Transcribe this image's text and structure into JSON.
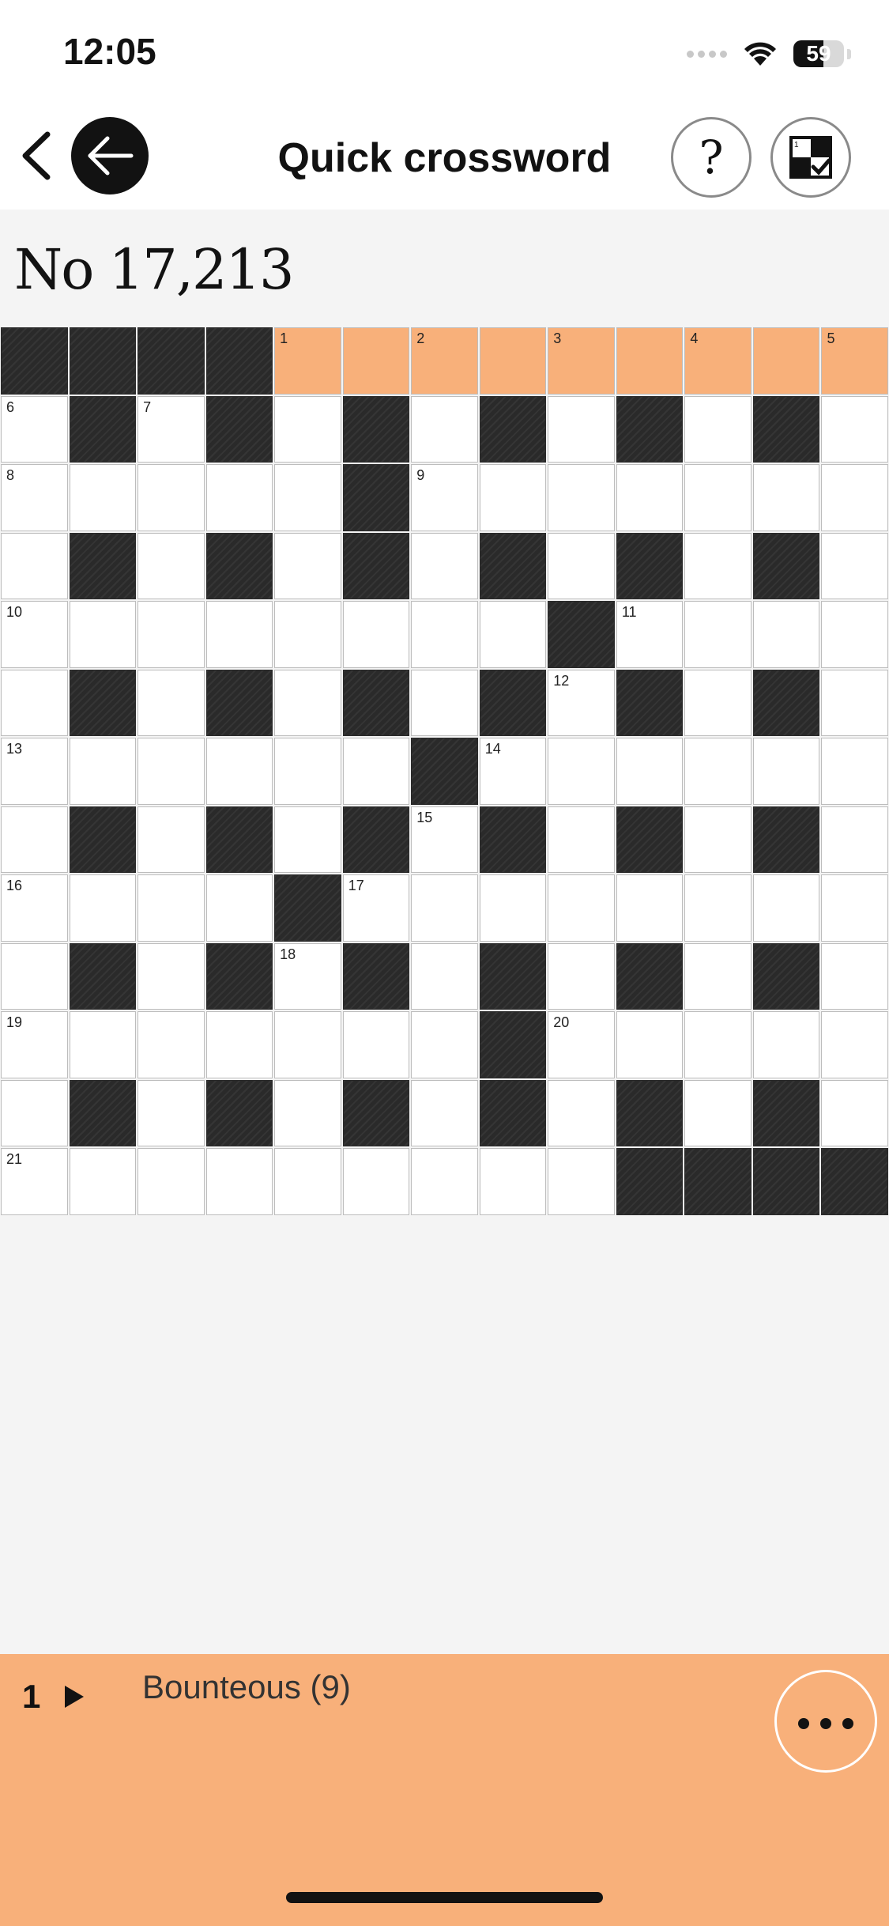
{
  "status_bar": {
    "time": "12:05",
    "battery_level": "59",
    "battery_fraction": 0.59
  },
  "header": {
    "title": "Quick crossword",
    "back_icon": "chevron-left-icon",
    "close_icon": "arrow-left-icon",
    "help_label": "?",
    "check_icon": "grid-check-icon"
  },
  "puzzle": {
    "number": "No 17,213"
  },
  "grid": {
    "rows": 13,
    "cols": 13,
    "accent_color": "#f8b07a",
    "layout": [
      "####.........",
      ".#.#.#.#.#.#.",
      ".....#.......",
      ".#.#.#.#.#.#.",
      "........#....",
      ".#.#.#.#.#.#.",
      "......#......",
      ".#.#.#.#.#.#.",
      "....#........",
      ".#.#.#.#.#.#.",
      ".......#.....",
      ".#.#.#.#.#.#.",
      ".........####"
    ],
    "active_row": 0,
    "active_from_col": 4,
    "numbers": [
      {
        "row": 0,
        "col": 4,
        "n": "1"
      },
      {
        "row": 0,
        "col": 6,
        "n": "2"
      },
      {
        "row": 0,
        "col": 8,
        "n": "3"
      },
      {
        "row": 0,
        "col": 10,
        "n": "4"
      },
      {
        "row": 0,
        "col": 12,
        "n": "5"
      },
      {
        "row": 1,
        "col": 0,
        "n": "6"
      },
      {
        "row": 1,
        "col": 2,
        "n": "7"
      },
      {
        "row": 2,
        "col": 0,
        "n": "8"
      },
      {
        "row": 2,
        "col": 6,
        "n": "9"
      },
      {
        "row": 4,
        "col": 0,
        "n": "10"
      },
      {
        "row": 4,
        "col": 9,
        "n": "11"
      },
      {
        "row": 5,
        "col": 8,
        "n": "12"
      },
      {
        "row": 6,
        "col": 0,
        "n": "13"
      },
      {
        "row": 6,
        "col": 7,
        "n": "14"
      },
      {
        "row": 7,
        "col": 6,
        "n": "15"
      },
      {
        "row": 8,
        "col": 0,
        "n": "16"
      },
      {
        "row": 8,
        "col": 5,
        "n": "17"
      },
      {
        "row": 9,
        "col": 4,
        "n": "18"
      },
      {
        "row": 10,
        "col": 0,
        "n": "19"
      },
      {
        "row": 10,
        "col": 8,
        "n": "20"
      },
      {
        "row": 12,
        "col": 0,
        "n": "21"
      }
    ]
  },
  "clue": {
    "number": "1",
    "text": "Bounteous (9)",
    "more_icon": "more-dots-icon"
  }
}
